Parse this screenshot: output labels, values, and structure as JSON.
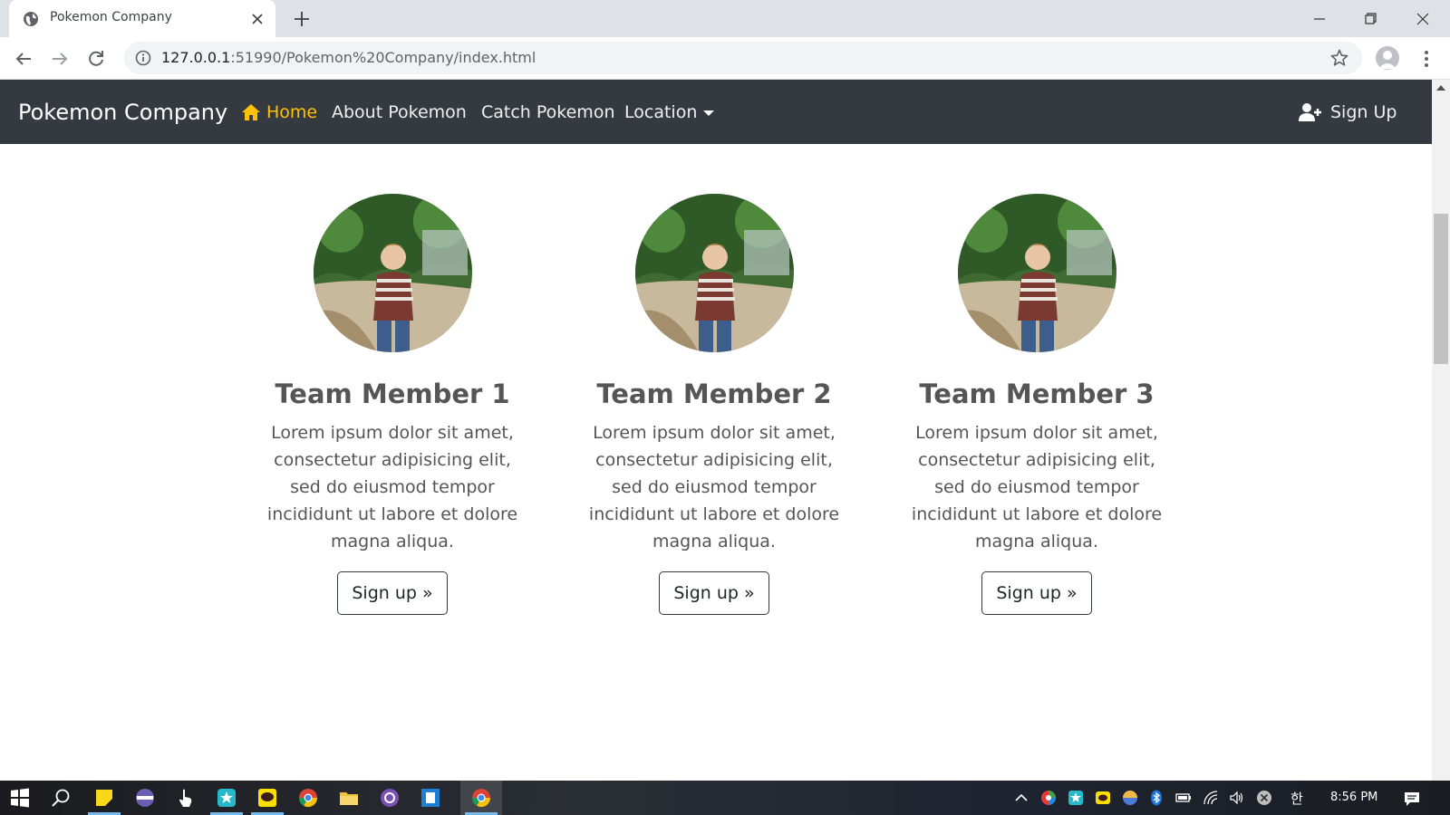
{
  "browser": {
    "tab_title": "Pokemon Company",
    "url_host": "127.0.0.1",
    "url_rest": ":51990/Pokemon%20Company/index.html"
  },
  "site_nav": {
    "brand": "Pokemon Company",
    "links": [
      {
        "label": "Home",
        "active": true
      },
      {
        "label": "About Pokemon",
        "active": false
      },
      {
        "label": "Catch Pokemon",
        "active": false
      },
      {
        "label": "Location",
        "active": false
      }
    ],
    "signup_label": "Sign Up",
    "active_color": "#ffc107",
    "background": "#343a40"
  },
  "team": [
    {
      "name": "Team Member 1",
      "text": "Lorem ipsum dolor sit amet, consectetur adipisicing elit, sed do eiusmod tempor incididunt ut labore et dolore magna aliqua.",
      "button": "Sign up »"
    },
    {
      "name": "Team Member 2",
      "text": "Lorem ipsum dolor sit amet, consectetur adipisicing elit, sed do eiusmod tempor incididunt ut labore et dolore magna aliqua.",
      "button": "Sign up »"
    },
    {
      "name": "Team Member 3",
      "text": "Lorem ipsum dolor sit amet, consectetur adipisicing elit, sed do eiusmod tempor incididunt ut labore et dolore magna aliqua.",
      "button": "Sign up »"
    }
  ],
  "taskbar": {
    "clock": "8:56 PM",
    "tray_lang": "한"
  }
}
